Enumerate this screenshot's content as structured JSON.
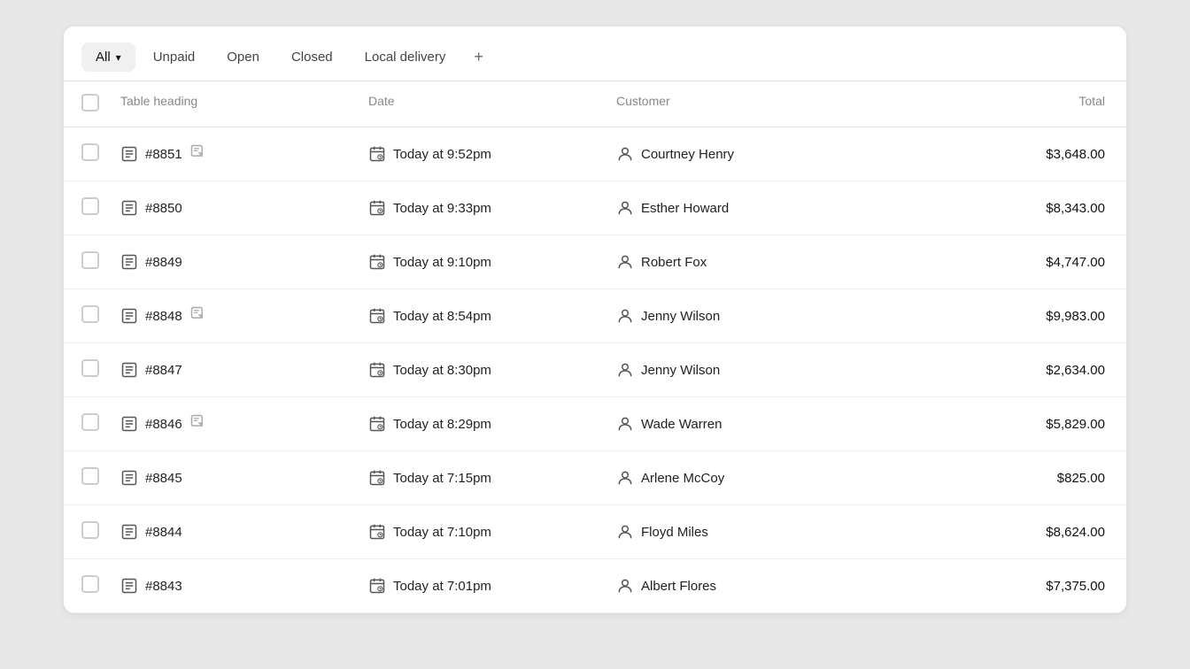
{
  "tabs": [
    {
      "id": "all",
      "label": "All",
      "hasChevron": true,
      "active": true
    },
    {
      "id": "unpaid",
      "label": "Unpaid",
      "hasChevron": false,
      "active": false
    },
    {
      "id": "open",
      "label": "Open",
      "hasChevron": false,
      "active": false
    },
    {
      "id": "closed",
      "label": "Closed",
      "hasChevron": false,
      "active": false
    },
    {
      "id": "local-delivery",
      "label": "Local delivery",
      "hasChevron": false,
      "active": false
    }
  ],
  "addTabLabel": "+",
  "table": {
    "headers": [
      "",
      "Table heading",
      "Date",
      "Customer",
      "Total"
    ],
    "rows": [
      {
        "id": "row-8851",
        "order": "#8851",
        "hasNote": true,
        "date": "Today at 9:52pm",
        "customer": "Courtney Henry",
        "total": "$3,648.00"
      },
      {
        "id": "row-8850",
        "order": "#8850",
        "hasNote": false,
        "date": "Today at 9:33pm",
        "customer": "Esther Howard",
        "total": "$8,343.00"
      },
      {
        "id": "row-8849",
        "order": "#8849",
        "hasNote": false,
        "date": "Today at 9:10pm",
        "customer": "Robert Fox",
        "total": "$4,747.00"
      },
      {
        "id": "row-8848",
        "order": "#8848",
        "hasNote": true,
        "date": "Today at 8:54pm",
        "customer": "Jenny Wilson",
        "total": "$9,983.00"
      },
      {
        "id": "row-8847",
        "order": "#8847",
        "hasNote": false,
        "date": "Today at 8:30pm",
        "customer": "Jenny Wilson",
        "total": "$2,634.00"
      },
      {
        "id": "row-8846",
        "order": "#8846",
        "hasNote": true,
        "date": "Today at 8:29pm",
        "customer": "Wade Warren",
        "total": "$5,829.00"
      },
      {
        "id": "row-8845",
        "order": "#8845",
        "hasNote": false,
        "date": "Today at 7:15pm",
        "customer": "Arlene McCoy",
        "total": "$825.00"
      },
      {
        "id": "row-8844",
        "order": "#8844",
        "hasNote": false,
        "date": "Today at 7:10pm",
        "customer": "Floyd Miles",
        "total": "$8,624.00"
      },
      {
        "id": "row-8843",
        "order": "#8843",
        "hasNote": false,
        "date": "Today at 7:01pm",
        "customer": "Albert Flores",
        "total": "$7,375.00"
      }
    ]
  }
}
